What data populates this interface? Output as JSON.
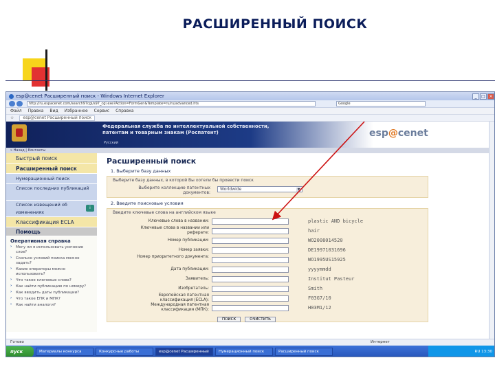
{
  "slide": {
    "title": "РАСШИРЕННЫЙ ПОИСК"
  },
  "browser": {
    "window_title": "esp@cenet Расширенный поиск - Windows Internet Explorer",
    "url": "http://ru.espacenet.com/search97cgi/s97_cgi.exe?Action=FormGen&Template=ru/ru/advanced.hts",
    "search_placeholder": "Google",
    "menu": [
      "Файл",
      "Правка",
      "Вид",
      "Избранное",
      "Сервис",
      "Справка"
    ],
    "fav_tab": "esp@cenet Расширенный поиск",
    "status_text": "Готово",
    "zone_text": "Интернет"
  },
  "header": {
    "org_line1": "Федеральная служба по интеллектуальной собственности,",
    "org_line2": "патентам и товарным знакам (Роспатент)",
    "logo_pre": "esp",
    "logo_accent": "@",
    "logo_post": "cenet",
    "sub": "Русский",
    "nav": "» Назад | Контакты"
  },
  "sidebar": {
    "items": [
      {
        "label": "Быстрый поиск",
        "style": "yellow"
      },
      {
        "label": "Расширенный поиск",
        "style": "active"
      },
      {
        "label": "Нумерационный поиск",
        "style": "yellow"
      },
      {
        "label": "Список последних публикаций",
        "style": "two"
      },
      {
        "label": "Список извещений об изменениях",
        "style": "two",
        "badge": "i"
      },
      {
        "label": "Классификация ECLA",
        "style": "yellow"
      },
      {
        "label": "Помощь",
        "style": "dark"
      }
    ],
    "help_title": "Оперативная справка",
    "help_items": [
      "Могу ли я использовать усечение слов?",
      "Сколько условий поиска можно задать?",
      "Какие операторы можно использовать?",
      "Что такое ключевые слова?",
      "Как найти публикацию по номеру?",
      "Как вводить даты публикации?",
      "Что такое ЕПК и МПК?",
      "Как найти аналоги?"
    ]
  },
  "form": {
    "title": "Расширенный поиск",
    "step1": "1. Выберите базу данных",
    "db_desc": "Выберите базу данных, в которой Вы хотели бы провести поиск",
    "db_label": "Выберите коллекцию патентных документов:",
    "db_value": "Worldwide",
    "step2": "2. Введите поисковые условия",
    "field_note": "Введите ключевые слова на английском языке",
    "fields": [
      {
        "label": "Ключевые слова в названии:",
        "example": "plastic AND bicycle"
      },
      {
        "label": "Ключевые слова в названии или реферате:",
        "example": "hair"
      },
      {
        "label": "Номер публикации:",
        "example": "WO2008014520"
      },
      {
        "label": "Номер заявки:",
        "example": "DE19971031696"
      },
      {
        "label": "Номер приоритетного документа:",
        "example": "WO1995US15925"
      },
      {
        "label": "Дата публикации:",
        "example": "yyyymmdd"
      },
      {
        "label": "Заявитель:",
        "example": "Institut Pasteur"
      },
      {
        "label": "Изобретатель:",
        "example": "Smith"
      },
      {
        "label": "Европейская патентная классификация (ECLA):",
        "example": "F03G7/10"
      },
      {
        "label": "Международная патентная классификация (МПК):",
        "example": "H03M1/12"
      }
    ],
    "search_button": "ПОИСК",
    "clear_button": "ОЧИСТИТЬ"
  },
  "taskbar": {
    "start": "пуск",
    "items": [
      "Материалы конкурса",
      "Конкурсные работы",
      "esp@cenet Расширенный",
      "Нумерационный поиск",
      "Расширенный поиск"
    ],
    "tray": "RU 13:30"
  },
  "annotation": {
    "arrow_color": "#cc1111"
  }
}
